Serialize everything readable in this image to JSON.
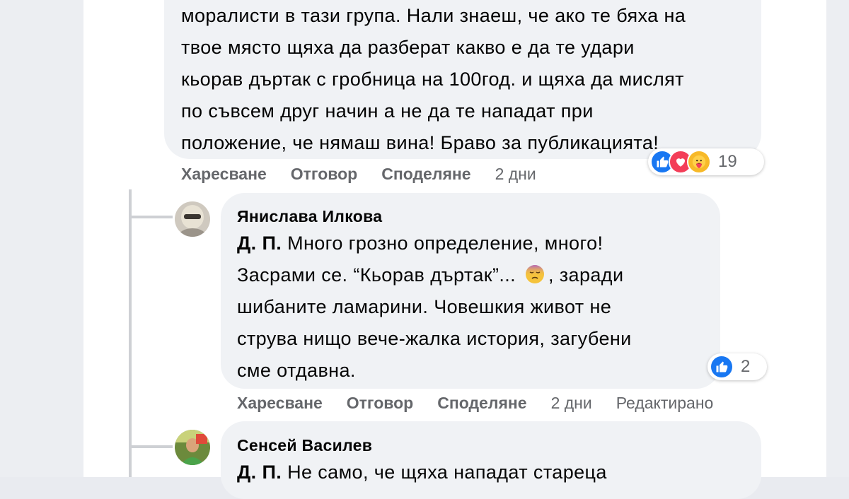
{
  "comment1": {
    "text": "моралисти в тази група. Нали знаеш, че ако те бяха на\nтвое място щяха да разберат какво е да те удари\nкьорав дъртак с гробница на 100год. и щяха да мислят\nпо съвсем друг начин а не да те нападат при\nположение, че нямаш вина! Браво за публикацията!",
    "reaction_count": "19",
    "actions": {
      "like": "Харесване",
      "reply": "Отговор",
      "share": "Споделяне",
      "time": "2 дни"
    }
  },
  "comment2": {
    "author": "Янислава Илкова",
    "mention": "Д. П.",
    "text_part1": "Много грозно определение, много!\nЗасрами се. “Кьорав дъртак”...",
    "emoji": "pensive-face-emoji",
    "text_part2": ", заради\nшибаните ламарини. Човешкия живот не\nструва нищо вече-жалка история, загубени\nсме отдавна.",
    "reaction_count": "2",
    "actions": {
      "like": "Харесване",
      "reply": "Отговор",
      "share": "Споделяне",
      "time": "2 дни",
      "edited": "Редактирано"
    }
  },
  "comment3": {
    "author": "Сенсей Василев",
    "mention": "Д. П.",
    "text": "Не само, че щяха нападат стареца"
  },
  "colors": {
    "bubble": "#f0f2f5",
    "like": "#1877f2",
    "love": "#f33e58",
    "care": "#f7b928",
    "muted_text": "#65676b"
  }
}
